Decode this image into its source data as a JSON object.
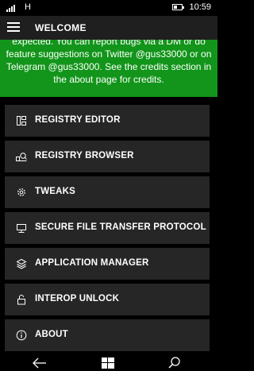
{
  "status_bar": {
    "network": "H",
    "time": "10:59"
  },
  "header": {
    "menu_icon": "hamburger-icon",
    "title": "WELCOME"
  },
  "notice": {
    "text": "expected. You can report bugs via a DM or do feature suggestions on Twitter @gus33000 or on Telegram @gus33000. See the credits section in the about page for credits."
  },
  "menu": {
    "items": [
      {
        "label": "REGISTRY EDITOR",
        "icon": "registry-editor-icon"
      },
      {
        "label": "REGISTRY BROWSER",
        "icon": "registry-browser-icon"
      },
      {
        "label": "TWEAKS",
        "icon": "gear-icon"
      },
      {
        "label": "SECURE FILE TRANSFER PROTOCOL",
        "icon": "computer-icon"
      },
      {
        "label": "APPLICATION MANAGER",
        "icon": "stack-icon"
      },
      {
        "label": "INTEROP UNLOCK",
        "icon": "lock-icon"
      },
      {
        "label": "ABOUT",
        "icon": "info-icon"
      }
    ]
  },
  "nav_bar": {
    "back": "back-arrow-icon",
    "home": "windows-logo-icon",
    "search": "search-icon"
  }
}
